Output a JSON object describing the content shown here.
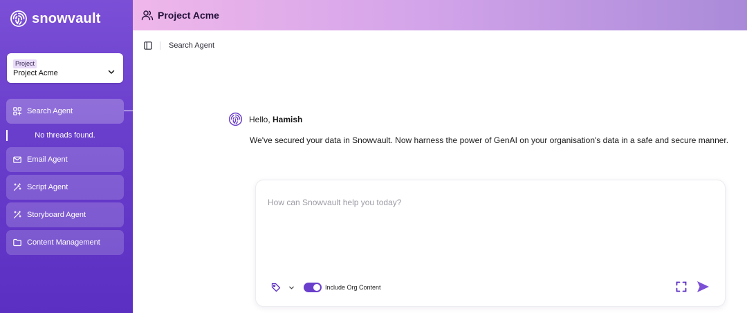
{
  "app": {
    "brand": "snowvault"
  },
  "project_selector": {
    "tag": "Project",
    "value": "Project Acme"
  },
  "sidebar": {
    "items": [
      {
        "label": "Search Agent",
        "icon": "grid-plus-icon",
        "active": true
      },
      {
        "label": "Email Agent",
        "icon": "mail-icon",
        "active": false
      },
      {
        "label": "Script Agent",
        "icon": "magic-wand-icon",
        "active": false
      },
      {
        "label": "Storyboard Agent",
        "icon": "magic-wand-icon",
        "active": false
      },
      {
        "label": "Content Management",
        "icon": "folder-icon",
        "active": false
      }
    ],
    "threads_empty": "No threads found."
  },
  "header": {
    "title": "Project Acme",
    "icon": "users-icon"
  },
  "toolbar": {
    "breadcrumb": "Search Agent",
    "icon": "sidebar-panel-icon"
  },
  "greeting": {
    "prefix": "Hello, ",
    "name": "Hamish",
    "message": "We've secured your data in Snowvault. Now harness the power of GenAI on your organisation's data in a safe and secure manner."
  },
  "composer": {
    "placeholder": "How can Snowvault help you today?",
    "value": "",
    "toggle_label": "Include Org Content",
    "toggle_on": true
  },
  "colors": {
    "accent": "#6a3fcc",
    "sidebar_top": "#7b4fd6",
    "sidebar_bottom": "#5b2fc2",
    "header_start": "#efb7ea",
    "header_end": "#a98ad9"
  }
}
